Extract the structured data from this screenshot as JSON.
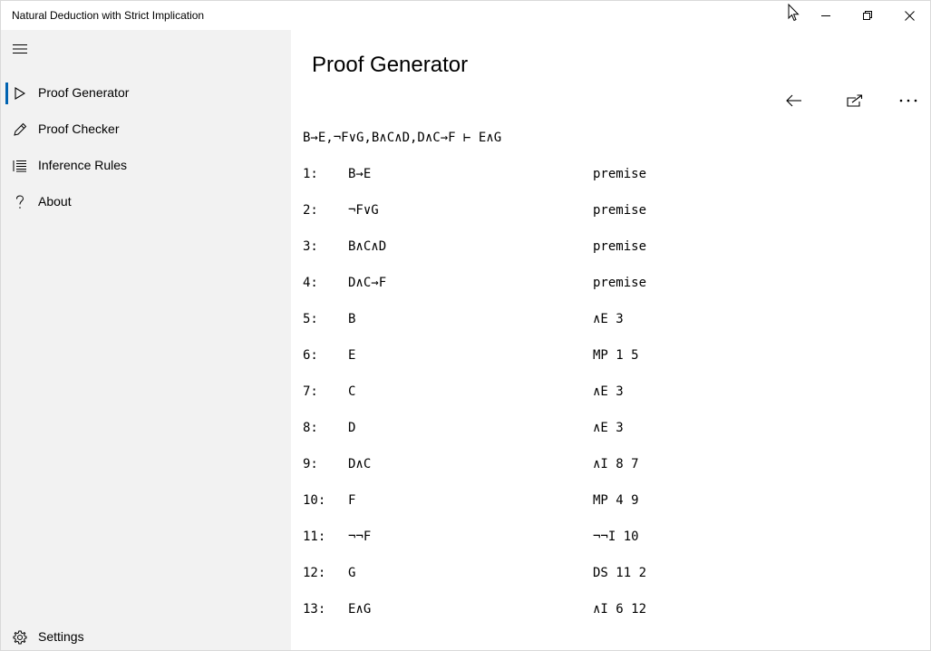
{
  "window": {
    "title": "Natural Deduction with Strict Implication"
  },
  "sidebar": {
    "items": [
      {
        "label": "Proof Generator",
        "icon": "play-icon",
        "selected": true
      },
      {
        "label": "Proof Checker",
        "icon": "pencil-icon",
        "selected": false
      },
      {
        "label": "Inference Rules",
        "icon": "list-icon",
        "selected": false
      },
      {
        "label": "About",
        "icon": "question-icon",
        "selected": false
      }
    ],
    "settings_label": "Settings"
  },
  "main": {
    "page_title": "Proof Generator",
    "sequent": "B→E,¬F∨G,B∧C∧D,D∧C→F ⊢ E∧G",
    "proof": [
      {
        "num": "1:",
        "formula": "B→E",
        "justification": "premise"
      },
      {
        "num": "2:",
        "formula": "¬F∨G",
        "justification": "premise"
      },
      {
        "num": "3:",
        "formula": "B∧C∧D",
        "justification": "premise"
      },
      {
        "num": "4:",
        "formula": "D∧C→F",
        "justification": "premise"
      },
      {
        "num": "5:",
        "formula": "B",
        "justification": "∧E 3"
      },
      {
        "num": "6:",
        "formula": "E",
        "justification": "MP 1 5"
      },
      {
        "num": "7:",
        "formula": "C",
        "justification": "∧E 3"
      },
      {
        "num": "8:",
        "formula": "D",
        "justification": "∧E 3"
      },
      {
        "num": "9:",
        "formula": "D∧C",
        "justification": "∧I 8 7"
      },
      {
        "num": "10:",
        "formula": "F",
        "justification": "MP 4 9"
      },
      {
        "num": "11:",
        "formula": "¬¬F",
        "justification": "¬¬I 10"
      },
      {
        "num": "12:",
        "formula": "G",
        "justification": "DS 11 2"
      },
      {
        "num": "13:",
        "formula": "E∧G",
        "justification": "∧I 6 12"
      }
    ]
  },
  "colors": {
    "accent": "#0063b1",
    "sidebar_bg": "#f2f2f2"
  }
}
